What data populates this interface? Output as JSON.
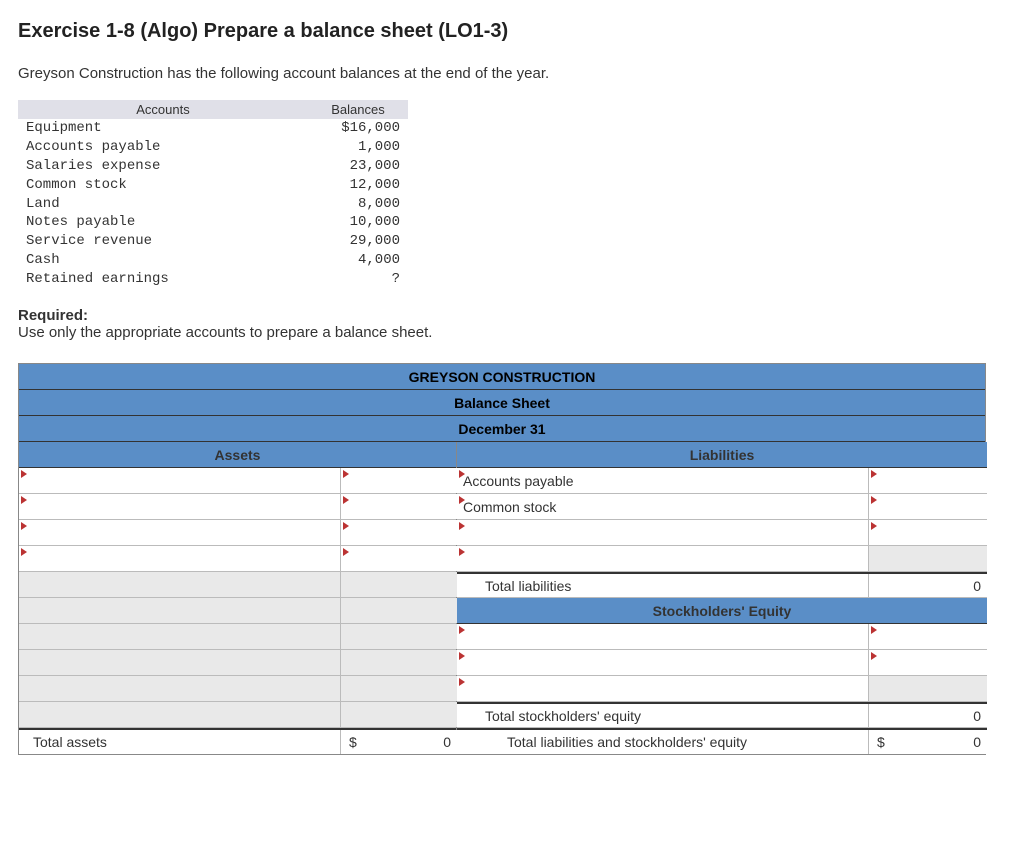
{
  "title": "Exercise 1-8 (Algo) Prepare a balance sheet (LO1-3)",
  "intro": "Greyson Construction has the following account balances at the end of the year.",
  "accounts_table": {
    "head_accounts": "Accounts",
    "head_balances": "Balances",
    "rows": [
      {
        "name": "Equipment",
        "balance": "$16,000"
      },
      {
        "name": "Accounts payable",
        "balance": "1,000"
      },
      {
        "name": "Salaries expense",
        "balance": "23,000"
      },
      {
        "name": "Common stock",
        "balance": "12,000"
      },
      {
        "name": "Land",
        "balance": "8,000"
      },
      {
        "name": "Notes payable",
        "balance": "10,000"
      },
      {
        "name": "Service revenue",
        "balance": "29,000"
      },
      {
        "name": "Cash",
        "balance": "4,000"
      },
      {
        "name": "Retained earnings",
        "balance": "?"
      }
    ]
  },
  "required_label": "Required:",
  "required_text": "Use only the appropriate accounts to prepare a balance sheet.",
  "balance_sheet": {
    "company": "GREYSON CONSTRUCTION",
    "title": "Balance Sheet",
    "date": "December 31",
    "assets_header": "Assets",
    "liabilities_header": "Liabilities",
    "equity_header": "Stockholders' Equity",
    "prefill": {
      "liab_row1": "Accounts payable",
      "liab_row2": "Common stock"
    },
    "totals": {
      "total_liabilities_label": "Total liabilities",
      "total_liabilities_value": "0",
      "total_equity_label": "Total stockholders' equity",
      "total_equity_value": "0",
      "total_liab_equity_label": "Total liabilities and stockholders' equity",
      "total_liab_equity_value": "0",
      "total_assets_label": "Total assets",
      "total_assets_value": "0"
    }
  }
}
